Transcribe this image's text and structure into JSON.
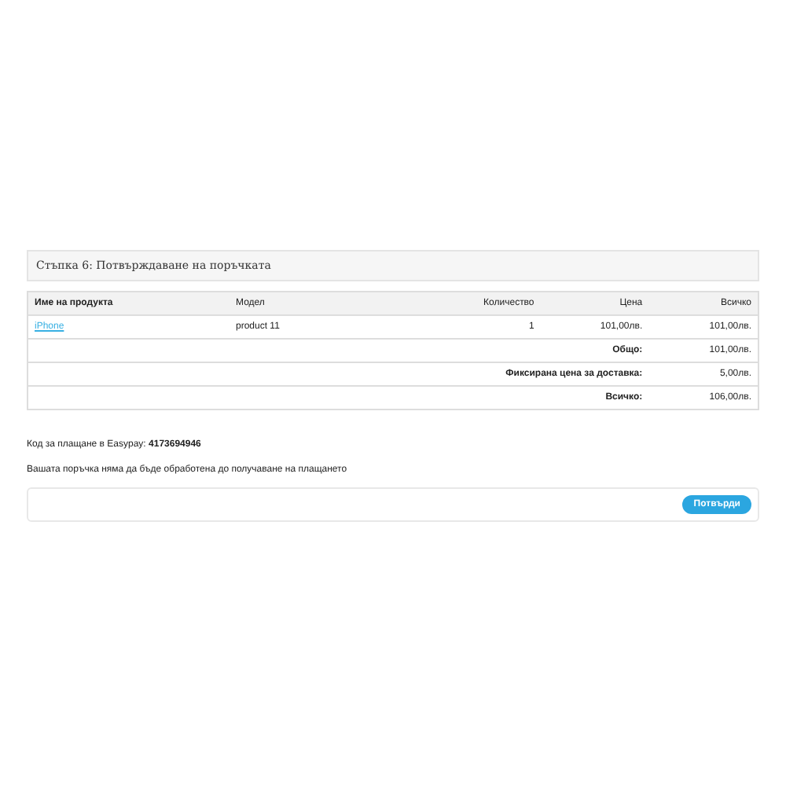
{
  "heading": "Стъпка 6: Потвърждаване на поръчката",
  "table": {
    "columns": [
      "Име на продукта",
      "Модел",
      "Количество",
      "Цена",
      "Всичко"
    ],
    "rows": [
      {
        "name": "iPhone",
        "model": "product 11",
        "quantity": "1",
        "price": "101,00лв.",
        "total": "101,00лв."
      }
    ],
    "totals": [
      {
        "label": "Общо:",
        "value": "101,00лв."
      },
      {
        "label": "Фиксирана цена за доставка:",
        "value": "5,00лв."
      },
      {
        "label": "Всичко:",
        "value": "106,00лв."
      }
    ]
  },
  "payment_code": {
    "text": "Код за плащане в Easypay: **4173694946**"
  },
  "notice": "Вашата поръчка няма да бъде обработена до получаване на плащането",
  "confirm_button": "Потвърди"
}
